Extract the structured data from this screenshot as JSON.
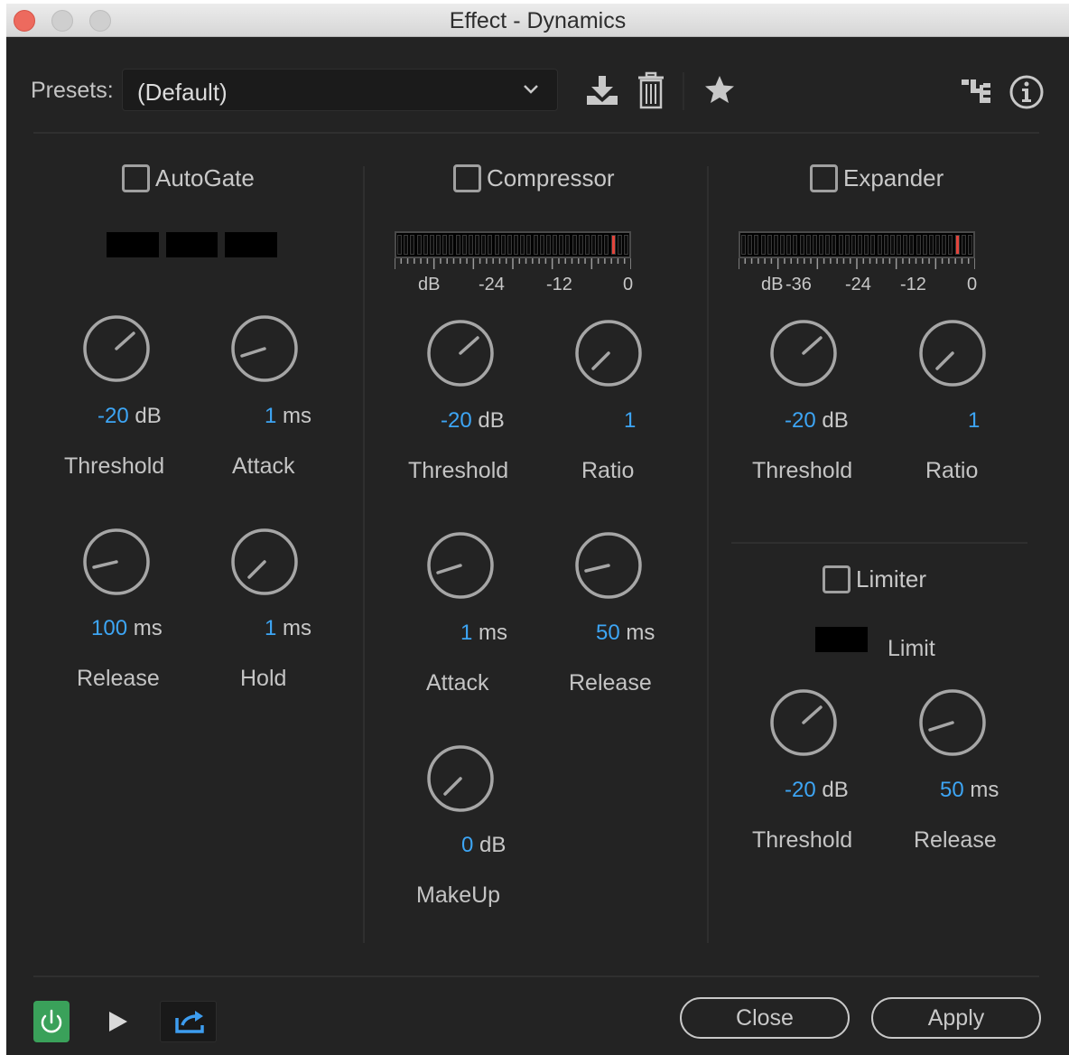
{
  "window": {
    "title": "Effect - Dynamics"
  },
  "presets": {
    "label": "Presets:",
    "value": "(Default)"
  },
  "toolbar": {
    "icons": [
      "download-icon",
      "trash-icon",
      "star-icon",
      "routing-icon",
      "info-icon"
    ]
  },
  "autogate": {
    "label": "AutoGate",
    "enabled": false,
    "knobs": [
      {
        "num": "-20",
        "unit": "dB",
        "label": "Threshold"
      },
      {
        "num": "1",
        "unit": "ms",
        "label": "Attack"
      },
      {
        "num": "100",
        "unit": "ms",
        "label": "Release"
      },
      {
        "num": "1",
        "unit": "ms",
        "label": "Hold"
      }
    ]
  },
  "compressor": {
    "label": "Compressor",
    "enabled": false,
    "meter_labels": [
      "dB",
      "-24",
      "-12",
      "0"
    ],
    "knobs": [
      {
        "num": "-20",
        "unit": "dB",
        "label": "Threshold"
      },
      {
        "num": "1",
        "unit": "",
        "label": "Ratio"
      },
      {
        "num": "1",
        "unit": "ms",
        "label": "Attack"
      },
      {
        "num": "50",
        "unit": "ms",
        "label": "Release"
      },
      {
        "num": "0",
        "unit": "dB",
        "label": "MakeUp"
      }
    ]
  },
  "expander": {
    "label": "Expander",
    "enabled": false,
    "meter_labels": [
      "dB",
      "-36",
      "-24",
      "-12",
      "0"
    ],
    "knobs": [
      {
        "num": "-20",
        "unit": "dB",
        "label": "Threshold"
      },
      {
        "num": "1",
        "unit": "",
        "label": "Ratio"
      }
    ]
  },
  "limiter": {
    "label": "Limiter",
    "enabled": false,
    "limit_label": "Limit",
    "knobs": [
      {
        "num": "-20",
        "unit": "dB",
        "label": "Threshold"
      },
      {
        "num": "50",
        "unit": "ms",
        "label": "Release"
      }
    ]
  },
  "footer": {
    "close_label": "Close",
    "apply_label": "Apply"
  },
  "colors": {
    "accent_blue": "#3da5f4",
    "power_green": "#3aa15a",
    "meter_red": "#e2453c"
  }
}
